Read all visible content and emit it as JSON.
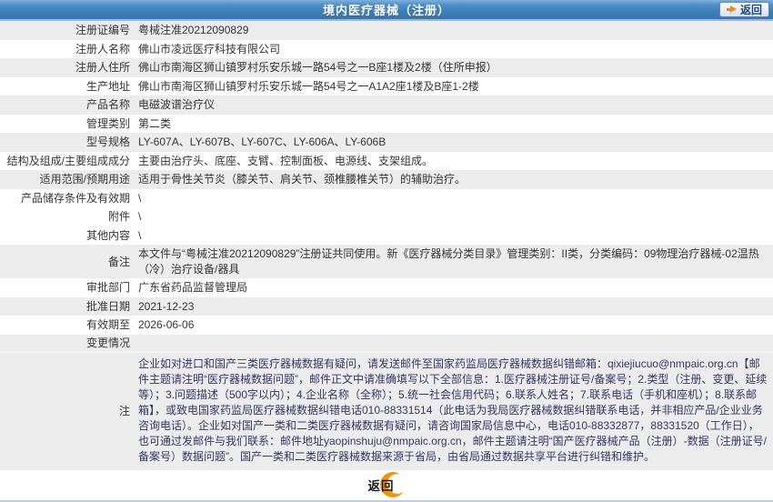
{
  "colors": {
    "header_blue": "#3c7fba",
    "header_blue_light": "#7db0da",
    "row_shade_gray": "#ececec",
    "accent_orange": "#ef940f",
    "note_text_navy": "#34376a",
    "back_button_text_blue": "#1d4b7e",
    "bottom_rule_blue": "#b9cfe2"
  },
  "header": {
    "title": "境内医疗器械（注册）",
    "back_button": {
      "label": "返回",
      "icon": "arrow-right-icon"
    }
  },
  "table": {
    "rows": [
      {
        "label": "注册证编号",
        "value": "粤械注准20212090829"
      },
      {
        "label": "注册人名称",
        "value": "佛山市凌远医疗科技有限公司"
      },
      {
        "label": "注册人住所",
        "value": "佛山市南海区狮山镇罗村乐安乐城一路54号之一B座1楼及2楼（住所申报）"
      },
      {
        "label": "生产地址",
        "value": "佛山市南海区狮山镇罗村乐安乐城一路54号之一A1A2座1楼及B座1-2楼"
      },
      {
        "label": "产品名称",
        "value": "电磁波谱治疗仪"
      },
      {
        "label": "管理类别",
        "value": "第二类"
      },
      {
        "label": "型号规格",
        "value": "LY-607A、LY-607B、LY-607C、LY-606A、LY-606B"
      },
      {
        "label": "结构及组成/主要组成成分",
        "value": "主要由治疗头、底座、支臂、控制面板、电源线、支架组成。"
      },
      {
        "label": "适用范围/预期用途",
        "value": "适用于骨性关节炎（膝关节、肩关节、颈椎腰椎关节）的辅助治疗。"
      },
      {
        "label": "产品储存条件及有效期",
        "value": "\\"
      },
      {
        "label": "附件",
        "value": "\\"
      },
      {
        "label": "其他内容",
        "value": "\\"
      },
      {
        "label": "备注",
        "value": "本文件与“粤械注准20212090829”注册证共同使用。新《医疗器械分类目录》管理类别：II类，分类编码：09物理治疗器械-02温热（冷）治疗设备/器具"
      },
      {
        "label": "审批部门",
        "value": "广东省药品监督管理局"
      },
      {
        "label": "批准日期",
        "value": "2021-12-23"
      },
      {
        "label": "有效期至",
        "value": "2026-06-06"
      },
      {
        "label": "变更情况",
        "value": ""
      },
      {
        "label": "注",
        "value": "企业如对进口和国产三类医疗器械数据有疑问，请发送邮件至国家药监局医疗器械数据纠错邮箱：qixiejiucuo@nmpaic.org.cn【邮件主题请注明“医疗器械数据问题”，邮件正文中请准确填写以下全部信息：1.医疗器械注册证号/备案号；2.类型（注册、变更、延续等）；3.问题描述（500字以内）；4.企业名称（全称）；5.统一社会信用代码；6.联系人姓名；7.联系电话（手机和座机）；8.联系邮箱】，或致电国家药监局医疗器械数据纠错电话010-88331514（此电话为我局医疗器械数据纠错联系电话，并非相应产品/企业业务咨询电话）。企业如对国产一类和二类医疗器械数据有疑问，请咨询国家局信息中心，电话010-88332877，88331520（工作日），也可通过发邮件与我们联系：邮件地址yaopinshuju@nmpaic.org.cn，邮件主题请注明“国产医疗器械产品（注册）-数据（注册证号/备案号）数据问题”。国产一类和二类医疗器械数据来源于省局，由省局通过数据共享平台进行纠错和维护。"
      }
    ]
  },
  "footer": {
    "back_button": {
      "label": "返回",
      "icon": "crescent-icon"
    }
  }
}
